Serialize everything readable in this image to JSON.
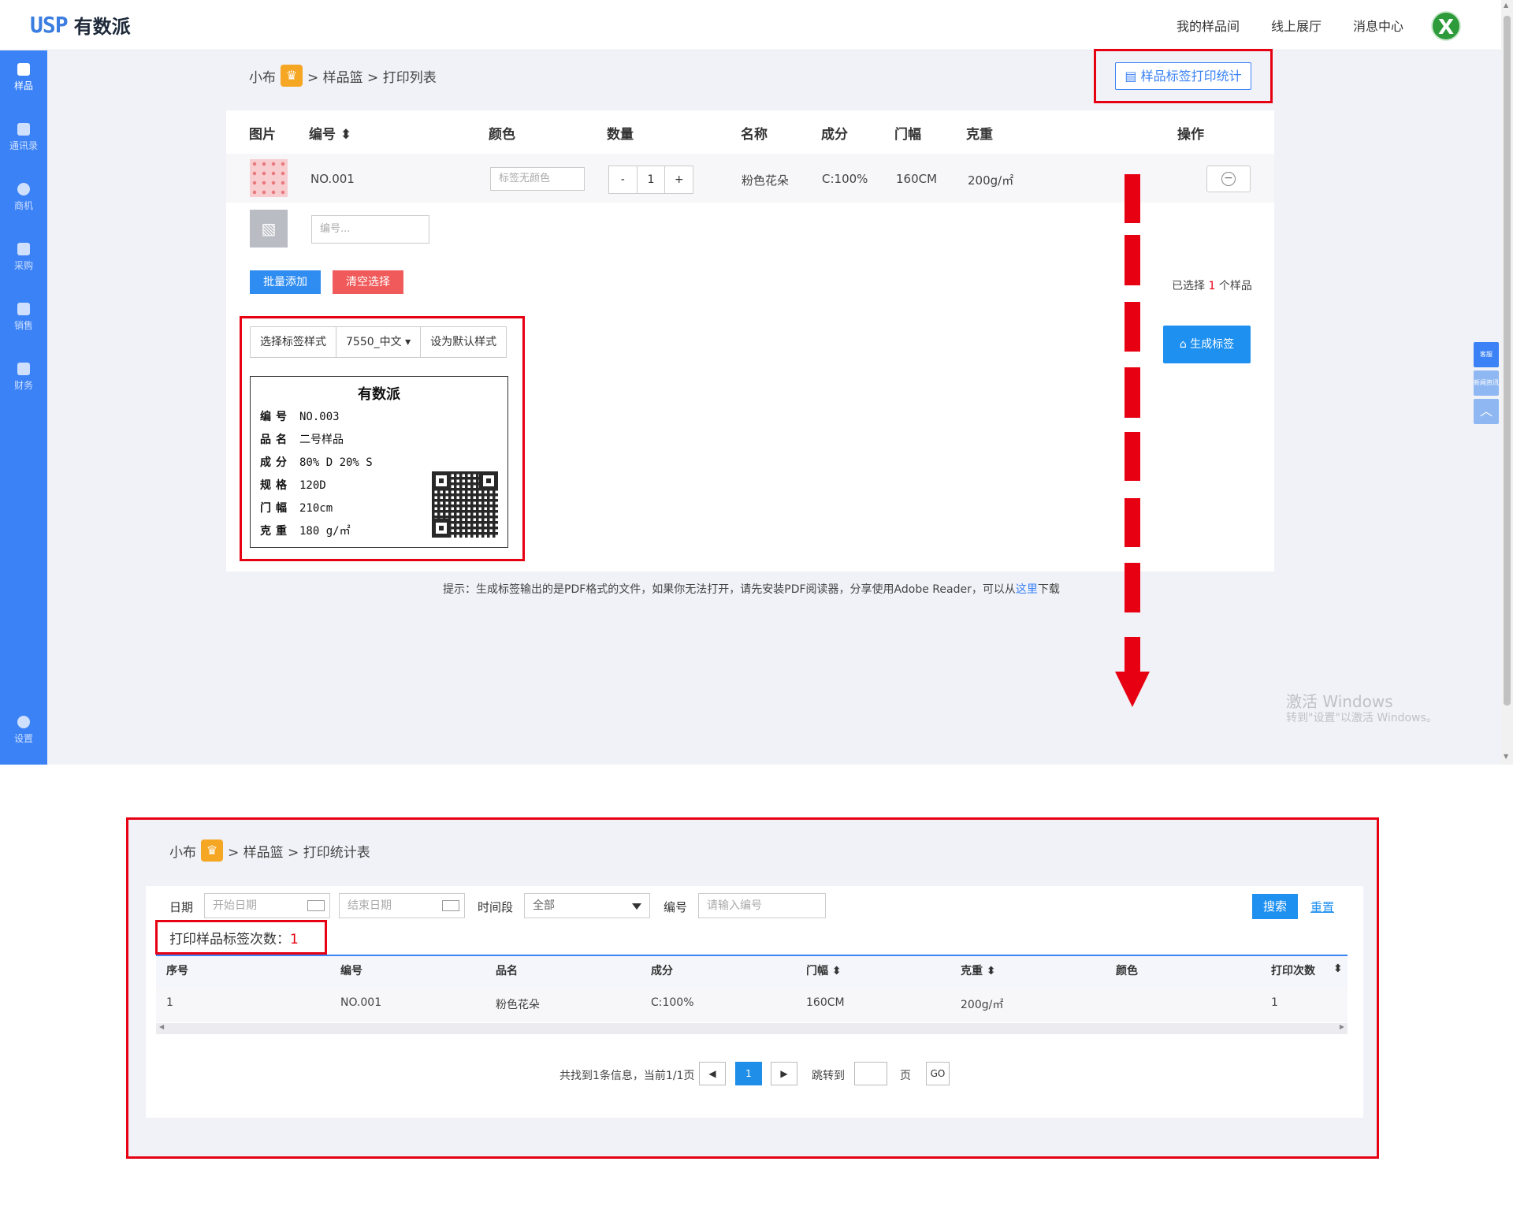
{
  "app": {
    "logo_mark": "USP",
    "logo_name": "有数派",
    "nav": [
      "我的样品间",
      "线上展厅",
      "消息中心"
    ],
    "avatar_letter": "X"
  },
  "sidebar": {
    "items": [
      {
        "label": "样品",
        "icon": "sample-icon"
      },
      {
        "label": "通讯录",
        "icon": "contacts-icon"
      },
      {
        "label": "商机",
        "icon": "opportunity-icon"
      },
      {
        "label": "采购",
        "icon": "purchase-icon"
      },
      {
        "label": "销售",
        "icon": "sales-icon"
      },
      {
        "label": "财务",
        "icon": "finance-icon"
      }
    ],
    "settings_label": "设置"
  },
  "print_page": {
    "breadcrumb": {
      "user": "小布",
      "crown": "♛",
      "path": "> 样品篮 > 打印列表"
    },
    "stats_button": "样品标签打印统计",
    "columns": [
      "图片",
      "编号 ⬍",
      "颜色",
      "数量",
      "名称",
      "成分",
      "门幅",
      "克重",
      "操作"
    ],
    "row": {
      "code": "NO.001",
      "color_placeholder": "标签无颜色",
      "qty_minus": "-",
      "qty": "1",
      "qty_plus": "+",
      "name": "粉色花朵",
      "composition": "C:100%",
      "width": "160CM",
      "weight": "200g/㎡",
      "remove": "−"
    },
    "new_code_placeholder": "编号...",
    "batch_add": "批量添加",
    "clear_selection": "清空选择",
    "selected_prefix": "已选择",
    "selected_count": "1",
    "selected_suffix": "个样品",
    "generate_button": "生成标签",
    "label_style_label": "选择标签样式",
    "label_style_value": "7550_中文 ▾",
    "set_default": "设为默认样式",
    "label_preview": {
      "title": "有数派",
      "rows": [
        {
          "k": "编号",
          "v": "NO.003"
        },
        {
          "k": "品名",
          "v": "二号样品"
        },
        {
          "k": "成分",
          "v": "80% D 20% S"
        },
        {
          "k": "规格",
          "v": "120D"
        },
        {
          "k": "门幅",
          "v": "210cm"
        },
        {
          "k": "克重",
          "v": "180 g/㎡"
        }
      ]
    },
    "tip_text": "提示：生成标签输出的是PDF格式的文件，如果你无法打开，请先安装PDF阅读器，分享使用Adobe Reader，可以从",
    "tip_link": "这里",
    "tip_tail": "下载"
  },
  "float_tools": [
    "客服",
    "新闻资讯",
    "︿"
  ],
  "watermark": {
    "line1": "激活 Windows",
    "line2": "转到\"设置\"以激活 Windows。"
  },
  "stats_page": {
    "breadcrumb": {
      "user": "小布",
      "crown": "♛",
      "path": "> 样品篮 > 打印统计表"
    },
    "filters": {
      "date_label": "日期",
      "start_placeholder": "开始日期",
      "end_placeholder": "结束日期",
      "period_label": "时间段",
      "period_value": "全部",
      "code_label": "编号",
      "code_placeholder": "请输入编号",
      "search": "搜索",
      "reset": "重置"
    },
    "count_label": "打印样品标签次数：",
    "count_value": "1",
    "columns": [
      "序号",
      "编号",
      "品名",
      "成分",
      "门幅 ⬍",
      "克重 ⬍",
      "颜色",
      "打印次数",
      "⬍"
    ],
    "rows": [
      [
        "1",
        "NO.001",
        "粉色花朵",
        "C:100%",
        "160CM",
        "200g/㎡",
        "",
        "1"
      ]
    ],
    "pagination": {
      "summary": "共找到1条信息，当前1/1页",
      "prev": "◀",
      "page": "1",
      "next": "▶",
      "jump_label": "跳转到",
      "page_unit": "页",
      "go": "GO"
    }
  }
}
